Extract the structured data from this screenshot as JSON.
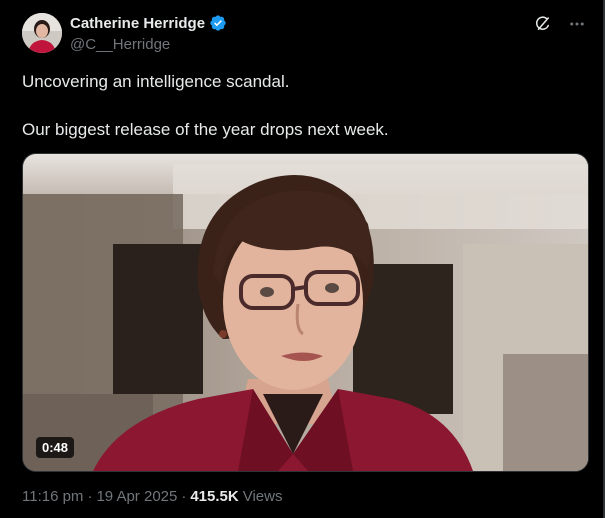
{
  "author": {
    "display_name": "Catherine Herridge",
    "handle": "@C__Herridge",
    "verified_color": "#1d9bf0"
  },
  "actions": {
    "grok_icon": "grok-icon",
    "more_icon": "more-icon"
  },
  "tweet": {
    "line1": "Uncovering an intelligence scandal.",
    "line2": "Our biggest release of the year drops next week."
  },
  "media": {
    "duration": "0:48"
  },
  "meta": {
    "time": "11:16 pm",
    "date": "19 Apr 2025",
    "separator": "·",
    "views_count": "415.5K",
    "views_label": "Views"
  }
}
